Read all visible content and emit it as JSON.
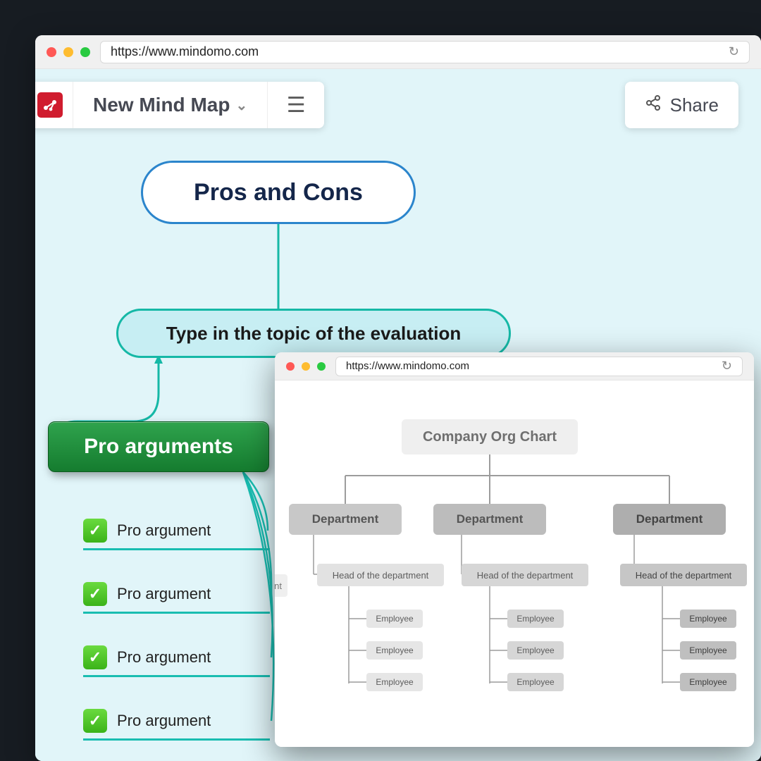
{
  "main_window": {
    "url": "https://www.mindomo.com",
    "toolbar": {
      "title": "New Mind Map",
      "share_label": "Share"
    },
    "mindmap": {
      "root": "Pros and Cons",
      "topic": "Type in the topic of the evaluation",
      "pro_section_title": "Pro arguments",
      "pro_items": [
        "Pro argument",
        "Pro argument",
        "Pro argument",
        "Pro argument"
      ]
    }
  },
  "secondary_window": {
    "url": "https://www.mindomo.com",
    "orgchart": {
      "root": "Company Org Chart",
      "partial_head_fragment": "nt",
      "departments": [
        {
          "name": "Department",
          "head": "Head of the department",
          "employees": [
            "Employee",
            "Employee",
            "Employee"
          ]
        },
        {
          "name": "Department",
          "head": "Head of the department",
          "employees": [
            "Employee",
            "Employee",
            "Employee"
          ]
        },
        {
          "name": "Department",
          "head": "Head of the department",
          "employees": [
            "Employee",
            "Employee",
            "Employee"
          ]
        }
      ]
    }
  }
}
